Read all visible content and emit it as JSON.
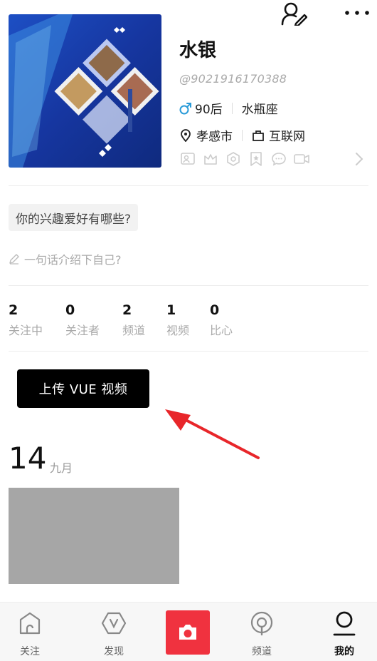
{
  "profile": {
    "name": "水银",
    "user_id": "@9021916170388",
    "gender_icon": "male-icon",
    "age_group": "90后",
    "zodiac": "水瓶座",
    "city": "孝感市",
    "industry": "互联网"
  },
  "interest_prompt": "你的兴趣爱好有哪些?",
  "intro_placeholder": "一句话介绍下自己?",
  "stats": [
    {
      "count": "2",
      "label": "关注中"
    },
    {
      "count": "0",
      "label": "关注者"
    },
    {
      "count": "2",
      "label": "频道"
    },
    {
      "count": "1",
      "label": "视频"
    },
    {
      "count": "0",
      "label": "比心"
    }
  ],
  "upload_button": "上传 VUE 视频",
  "date_group": {
    "day": "14",
    "month": "九月"
  },
  "tabs": [
    {
      "label": "关注",
      "icon": "home-icon"
    },
    {
      "label": "发现",
      "icon": "discover-icon"
    },
    {
      "label": "",
      "icon": "camera-icon"
    },
    {
      "label": "频道",
      "icon": "channel-icon"
    },
    {
      "label": "我的",
      "icon": "profile-icon"
    }
  ],
  "colors": {
    "accent": "#f0323f",
    "male": "#2a9bd8",
    "annotation_arrow": "#e8262a"
  }
}
